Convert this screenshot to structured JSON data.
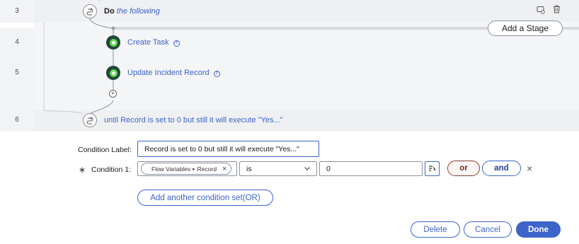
{
  "rows": [
    {
      "num": "3"
    },
    {
      "num": "4"
    },
    {
      "num": "5"
    },
    {
      "num": "6"
    }
  ],
  "do_step": {
    "keyword": "Do",
    "text": "the following"
  },
  "add_stage_label": "Add a Stage",
  "actions": [
    {
      "label": "Create Task",
      "help": "?"
    },
    {
      "label": "Update Incident Record",
      "help": "?"
    }
  ],
  "until_text": "until Record is set to 0 but still it will execute \"Yes...\"",
  "condition_form": {
    "label_caption": "Condition Label:",
    "label_value": "Record is set to 0 but still it will execute \"Yes...\"",
    "required_mark": "∗",
    "condition_caption": "Condition 1:",
    "pill_part1": "Flow Variables",
    "pill_sep": "▸",
    "pill_part2": "Record",
    "operator": "is",
    "value": "0",
    "or_label": "or",
    "and_label": "and",
    "add_condition_label": "Add another condition set(OR)"
  },
  "footer": {
    "delete_label": "Delete",
    "cancel_label": "Cancel",
    "done_label": "Done"
  },
  "colors": {
    "accent": "#3c64c9",
    "done_bg": "#3c64c9",
    "or_border": "#8a3c2e",
    "action_ring": "#62d84e",
    "action_bg": "#21473a"
  }
}
